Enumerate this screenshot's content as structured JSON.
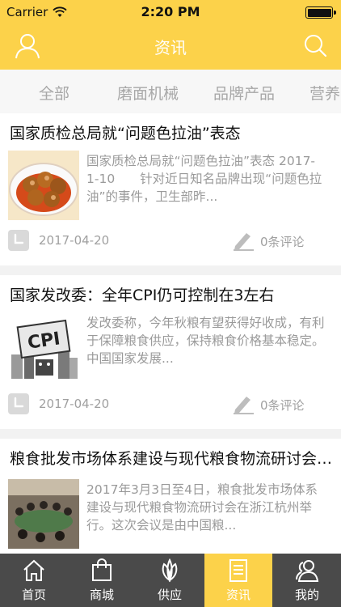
{
  "status_bar": {
    "carrier": "Carrier",
    "time": "2:20 PM"
  },
  "nav": {
    "title": "资讯",
    "left_icon": "user-icon",
    "right_icon": "search-icon"
  },
  "tabs": [
    {
      "label": "全部"
    },
    {
      "label": "磨面机械"
    },
    {
      "label": "品牌产品"
    },
    {
      "label": "营养"
    }
  ],
  "articles": [
    {
      "title": "国家质检总局就“问题色拉油”表态",
      "summary": "国家质检总局就“问题色拉油”表态 2017-1-10　　针对近日知名品牌出现“问题色拉油”的事件，卫生部昨...",
      "date": "2017-04-20",
      "comments": "0条评论",
      "thumb": "fried-food-plate"
    },
    {
      "title": "国家发改委：全年CPI仍可控制在3左右",
      "summary": "发改委称，今年秋粮有望获得好收成，有利于保障粮食供应，保持粮食价格基本稳定。　中国国家发展...",
      "date": "2017-04-20",
      "comments": "0条评论",
      "thumb": "cpi-illustration"
    },
    {
      "title": "粮食批发市场体系建设与现代粮食物流研讨会在浙江杭州举行",
      "summary": "2017年3月3日至4日，粮食批发市场体系建设与现代粮食物流研讨会在浙江杭州举行。这次会议是由中国粮...",
      "thumb": "meeting-photo"
    }
  ],
  "bottom_tabs": [
    {
      "label": "首页",
      "icon": "home-icon"
    },
    {
      "label": "商城",
      "icon": "shopping-bag-icon"
    },
    {
      "label": "供应",
      "icon": "leaf-icon"
    },
    {
      "label": "资讯",
      "icon": "document-icon",
      "active": true
    },
    {
      "label": "我的",
      "icon": "users-icon"
    }
  ],
  "colors": {
    "accent": "#fcd24a",
    "tabbar": "#4a4a4a",
    "muted_text": "#9a9a9a"
  }
}
